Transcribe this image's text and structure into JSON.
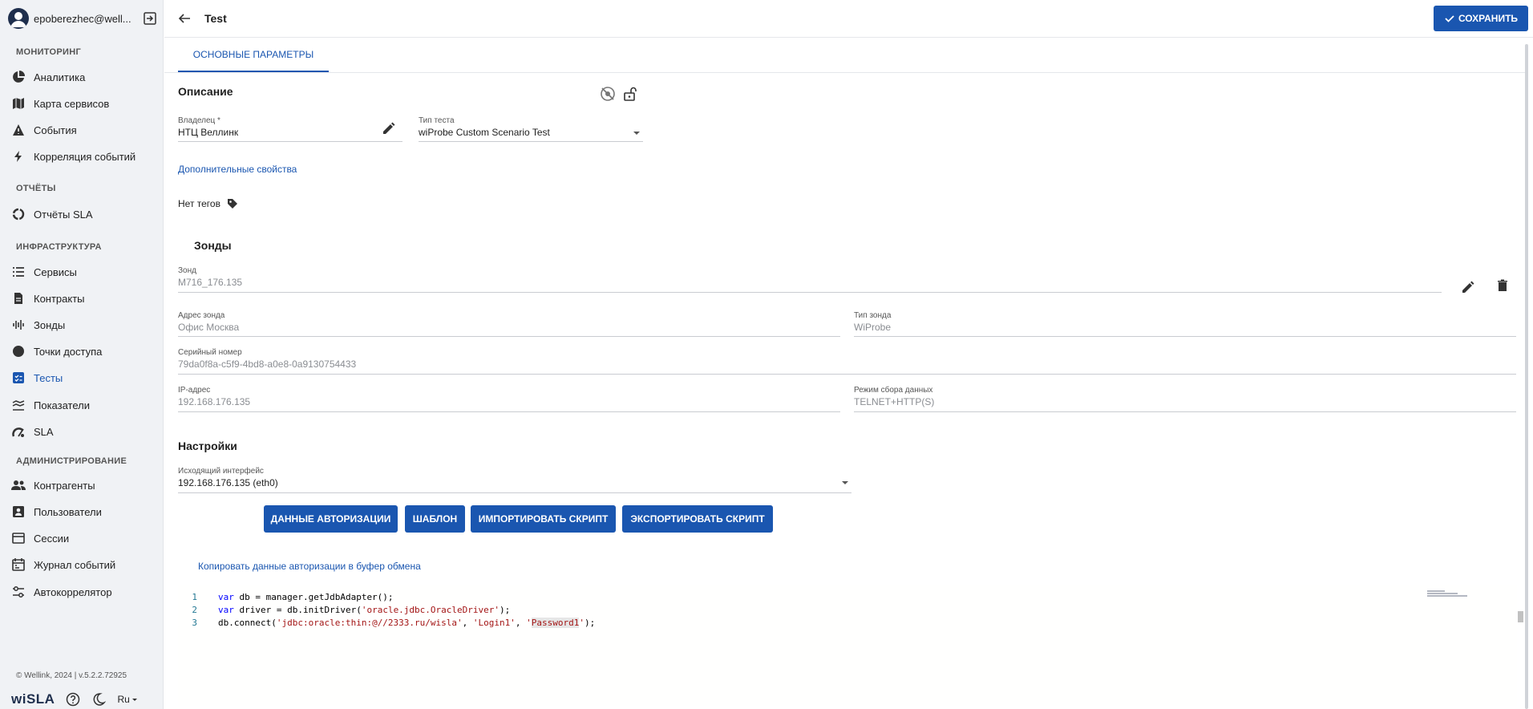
{
  "user": {
    "name": "epoberezhec@well..."
  },
  "sidebar": {
    "sections": [
      {
        "title": "МОНИТОРИНГ"
      },
      {
        "title": "ОТЧЁТЫ"
      },
      {
        "title": "ИНФРАСТРУКТУРА"
      },
      {
        "title": "АДМИНИСТРИРОВАНИЕ"
      }
    ],
    "items": [
      {
        "label": "Аналитика"
      },
      {
        "label": "Карта сервисов"
      },
      {
        "label": "События"
      },
      {
        "label": "Корреляция событий"
      },
      {
        "label": "Отчёты SLA"
      },
      {
        "label": "Сервисы"
      },
      {
        "label": "Контракты"
      },
      {
        "label": "Зонды"
      },
      {
        "label": "Точки доступа"
      },
      {
        "label": "Тесты"
      },
      {
        "label": "Показатели"
      },
      {
        "label": "SLA"
      },
      {
        "label": "Контрагенты"
      },
      {
        "label": "Пользователи"
      },
      {
        "label": "Сессии"
      },
      {
        "label": "Журнал событий"
      },
      {
        "label": "Автокоррелятор"
      }
    ],
    "active_item": "Тесты",
    "copyright": "© Wellink, 2024 | v.5.2.2.72925",
    "logo": "wiSLA",
    "language": "Ru"
  },
  "header": {
    "title": "Test",
    "save_label": "СОХРАНИТЬ"
  },
  "tabs": [
    {
      "label": "ОСНОВНЫЕ ПАРАМЕТРЫ"
    }
  ],
  "description": {
    "heading": "Описание",
    "owner": {
      "label": "Владелец *",
      "value": "НТЦ Веллинк"
    },
    "test_type": {
      "label": "Тип теста",
      "value": "wiProbe Custom Scenario Test"
    },
    "extra_props_link": "Дополнительные свойства",
    "no_tags": "Нет тегов"
  },
  "probes": {
    "heading": "Зонды",
    "probe": {
      "label": "Зонд",
      "value": "M716_176.135"
    },
    "address": {
      "label": "Адрес зонда",
      "value": "Офис Москва"
    },
    "probe_type": {
      "label": "Тип зонда",
      "value": "WiProbe"
    },
    "serial": {
      "label": "Серийный номер",
      "value": "79da0f8a-c5f9-4bd8-a0e8-0a9130754433"
    },
    "ip": {
      "label": "IP-адрес",
      "value": "192.168.176.135"
    },
    "collect_mode": {
      "label": "Режим сбора данных",
      "value": "TELNET+HTTP(S)"
    }
  },
  "settings": {
    "heading": "Настройки",
    "interface": {
      "label": "Исходящий интерфейс",
      "value": "192.168.176.135 (eth0)"
    },
    "buttons": {
      "auth": "ДАННЫЕ АВТОРИЗАЦИИ",
      "template": "ШАБЛОН",
      "import": "ИМПОРТИРОВАТЬ СКРИПТ",
      "export": "ЭКСПОРТИРОВАТЬ СКРИПТ"
    },
    "copy_link": "Копировать данные авторизации в буфер обмена"
  },
  "editor": {
    "lines": [
      {
        "num": "1",
        "code": "var db = manager.getJdbAdapter();"
      },
      {
        "num": "2",
        "code": "var driver = db.initDriver('oracle.jdbc.OracleDriver');"
      },
      {
        "num": "3",
        "code": "db.connect('jdbc:oracle:thin:@//2333.ru/wisla', 'Login1', 'Password1');"
      }
    ]
  },
  "colors": {
    "accent": "#1a56b0",
    "sidebar_bg": "#f0f2f5"
  }
}
